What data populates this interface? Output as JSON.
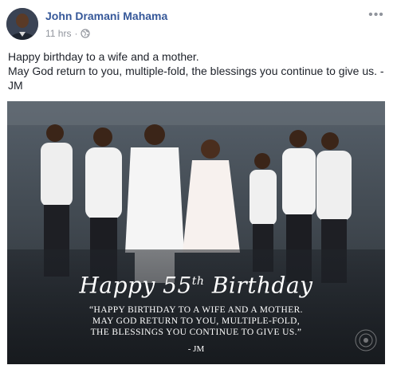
{
  "post": {
    "author": "John Dramani Mahama",
    "time": "11 hrs",
    "separator": "·",
    "privacy_icon": "globe-icon",
    "more_icon": "more-options-icon",
    "text_lines": [
      "Happy birthday to a wife and a mother.",
      "May God return to you, multiple-fold, the blessings you continue to give us. -",
      "JM"
    ]
  },
  "photo": {
    "title_main": "Happy 55",
    "title_sup": "th",
    "title_end": " Birthday",
    "quote_lines": [
      "“HAPPY BIRTHDAY TO A WIFE AND A MOTHER.",
      "MAY GOD RETURN TO YOU, MULTIPLE-FOLD,",
      "THE BLESSINGS YOU CONTINUE TO GIVE US.”"
    ],
    "signature": "- JM"
  },
  "colors": {
    "author_link": "#365899",
    "meta_text": "#90949c",
    "body_text": "#1d2129"
  }
}
